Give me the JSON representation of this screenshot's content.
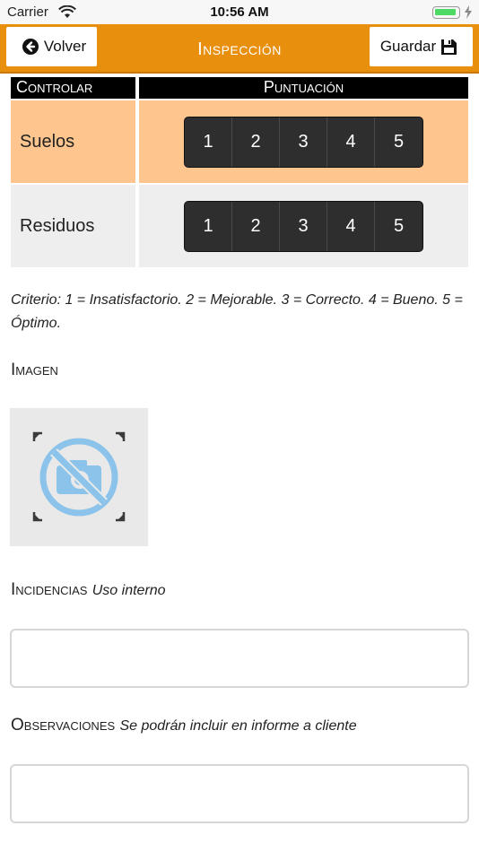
{
  "status_bar": {
    "carrier": "Carrier",
    "time": "10:56 AM"
  },
  "header": {
    "back_label": "Volver",
    "title": "Inspección",
    "save_label": "Guardar"
  },
  "table": {
    "col_control": "Controlar",
    "col_score": "Puntuación",
    "rows": [
      {
        "label": "Suelos",
        "highlighted": true,
        "scores": [
          "1",
          "2",
          "3",
          "4",
          "5"
        ]
      },
      {
        "label": "Residuos",
        "highlighted": false,
        "scores": [
          "1",
          "2",
          "3",
          "4",
          "5"
        ]
      }
    ]
  },
  "criterio": "Criterio: 1 = Insatisfactorio. 2 = Mejorable. 3 = Correcto. 4 = Bueno. 5 = Óptimo.",
  "imagen": {
    "label": "Imagen"
  },
  "incidencias": {
    "label": "Incidencias",
    "note": "Uso interno",
    "value": ""
  },
  "observaciones": {
    "label": "Observaciones",
    "note": "Se podrán incluir en informe a cliente",
    "value": ""
  },
  "colors": {
    "header": "#e8900e",
    "highlight_row": "#ffc58e",
    "segment": "#2e2e2e",
    "no_camera_icon": "#8cc3ea"
  },
  "icons": {
    "back": "arrow-left-circle",
    "save": "floppy-disk",
    "image_placeholder": "no-camera"
  }
}
